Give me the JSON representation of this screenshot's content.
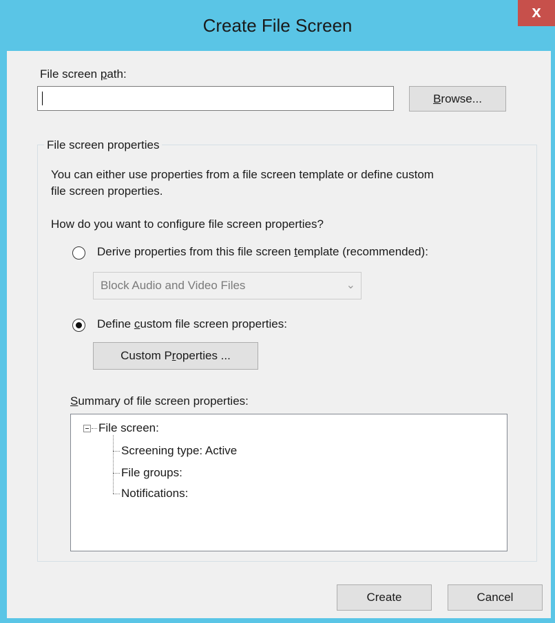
{
  "window": {
    "title": "Create File Screen",
    "close_label": "x"
  },
  "path": {
    "label_before": "File screen ",
    "label_accel": "p",
    "label_after": "ath:",
    "value": "",
    "browse_accel": "B",
    "browse_rest": "rowse..."
  },
  "properties": {
    "group_title": "File screen properties",
    "description_line1": "You can either use properties from a file screen template or define custom",
    "description_line2": "file screen properties.",
    "question": "How do you want to configure file screen properties?",
    "derive_label_before": "Derive properties from this file screen ",
    "derive_label_accel": "t",
    "derive_label_after": "emplate (recommended):",
    "template_selected": "Block Audio and Video Files",
    "custom_label_before": "Define ",
    "custom_label_accel": "c",
    "custom_label_after": "ustom file screen properties:",
    "custom_button_before": "Custom P",
    "custom_button_accel": "r",
    "custom_button_after": "operties ...",
    "selected_option": "custom"
  },
  "summary": {
    "label_accel": "S",
    "label_rest": "ummary of file screen properties:",
    "root": "File screen:",
    "children": [
      "Screening type: Active",
      "File groups:",
      "Notifications:"
    ]
  },
  "footer": {
    "create_label": "Create",
    "cancel_label": "Cancel"
  }
}
